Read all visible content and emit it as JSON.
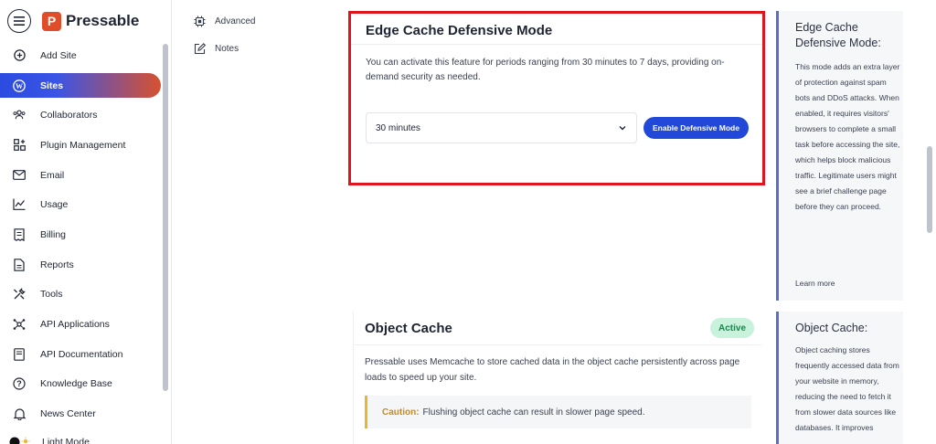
{
  "brand": {
    "name": "Pressable",
    "logo_letter": "P",
    "color": "#e04d2a"
  },
  "sidebar": {
    "items": [
      {
        "label": "Add Site",
        "icon": "plus-circle-icon",
        "active": false
      },
      {
        "label": "Sites",
        "icon": "wordpress-icon",
        "active": true
      },
      {
        "label": "Collaborators",
        "icon": "users-icon",
        "active": false
      },
      {
        "label": "Plugin Management",
        "icon": "plugin-grid-icon",
        "active": false
      },
      {
        "label": "Email",
        "icon": "envelope-icon",
        "active": false
      },
      {
        "label": "Usage",
        "icon": "line-chart-icon",
        "active": false
      },
      {
        "label": "Billing",
        "icon": "receipt-icon",
        "active": false
      },
      {
        "label": "Reports",
        "icon": "document-icon",
        "active": false
      },
      {
        "label": "Tools",
        "icon": "tools-icon",
        "active": false
      },
      {
        "label": "API Applications",
        "icon": "network-icon",
        "active": false
      },
      {
        "label": "API Documentation",
        "icon": "book-icon",
        "active": false
      },
      {
        "label": "Knowledge Base",
        "icon": "question-circle-icon",
        "active": false
      },
      {
        "label": "News Center",
        "icon": "bell-icon",
        "active": false
      }
    ],
    "mode_toggle": "Light Mode"
  },
  "subnav": {
    "items": [
      {
        "label": "Advanced",
        "icon": "chip-icon"
      },
      {
        "label": "Notes",
        "icon": "edit-icon"
      }
    ]
  },
  "edge_cache": {
    "title": "Edge Cache Defensive Mode",
    "description": "You can activate this feature for periods ranging from 30 minutes to 7 days, providing on-demand security as needed.",
    "duration_value": "30 minutes",
    "enable_button": "Enable Defensive Mode"
  },
  "object_cache": {
    "title": "Object Cache",
    "status": "Active",
    "description": "Pressable uses Memcache to store cached data in the object cache persistently across page loads to speed up your site.",
    "caution_label": "Caution:",
    "caution_text": "Flushing object cache can result in slower page speed."
  },
  "info_panels": {
    "edge": {
      "title": "Edge Cache Defensive Mode:",
      "body": "This mode adds an extra layer of protection against spam bots and DDoS attacks. When enabled, it requires visitors' browsers to complete a small task before accessing the site, which helps block malicious traffic. Legitimate users might see a brief challenge page before they can proceed.",
      "link": "Learn more"
    },
    "object": {
      "title": "Object Cache:",
      "body": "Object caching stores frequently accessed data from your website in memory, reducing the need to fetch it from slower data sources like databases. It improves"
    }
  },
  "colors": {
    "accent_blue": "#2148d8",
    "highlight_red": "#e0141c",
    "active_green": "#c9f2dc",
    "caution_yellow": "#e8b72a"
  }
}
